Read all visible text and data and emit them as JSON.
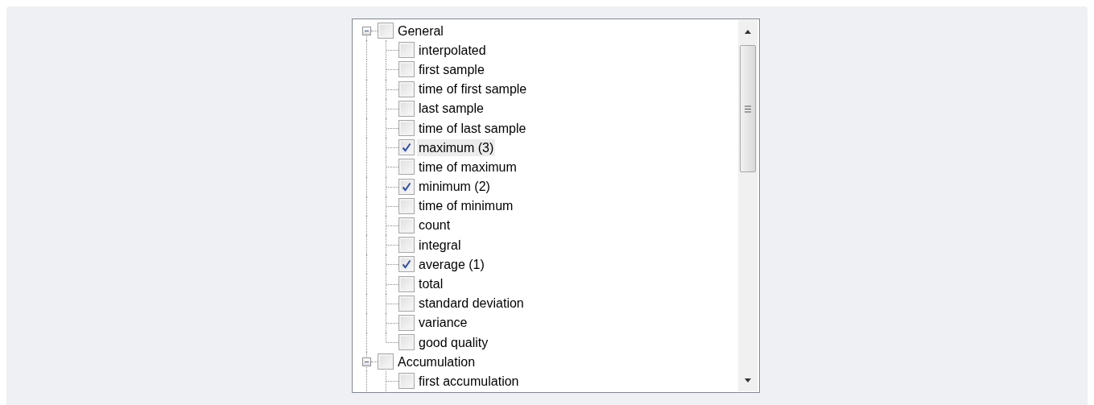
{
  "tree": {
    "groups": [
      {
        "label": "General",
        "expanded": true,
        "checked": false,
        "selected": false,
        "children": [
          {
            "label": "interpolated",
            "checked": false,
            "selected": false
          },
          {
            "label": "first sample",
            "checked": false,
            "selected": false
          },
          {
            "label": "time of first sample",
            "checked": false,
            "selected": false
          },
          {
            "label": "last sample",
            "checked": false,
            "selected": false
          },
          {
            "label": "time of last sample",
            "checked": false,
            "selected": false
          },
          {
            "label": "maximum (3)",
            "checked": true,
            "selected": true
          },
          {
            "label": "time of maximum",
            "checked": false,
            "selected": false
          },
          {
            "label": "minimum (2)",
            "checked": true,
            "selected": false
          },
          {
            "label": "time of minimum",
            "checked": false,
            "selected": false
          },
          {
            "label": "count",
            "checked": false,
            "selected": false
          },
          {
            "label": "integral",
            "checked": false,
            "selected": false
          },
          {
            "label": "average (1)",
            "checked": true,
            "selected": false
          },
          {
            "label": "total",
            "checked": false,
            "selected": false
          },
          {
            "label": "standard deviation",
            "checked": false,
            "selected": false
          },
          {
            "label": "variance",
            "checked": false,
            "selected": false
          },
          {
            "label": "good quality",
            "checked": false,
            "selected": false
          }
        ]
      },
      {
        "label": "Accumulation",
        "expanded": true,
        "checked": false,
        "selected": false,
        "children": [
          {
            "label": "first accumulation",
            "checked": false,
            "selected": false
          }
        ]
      }
    ]
  }
}
